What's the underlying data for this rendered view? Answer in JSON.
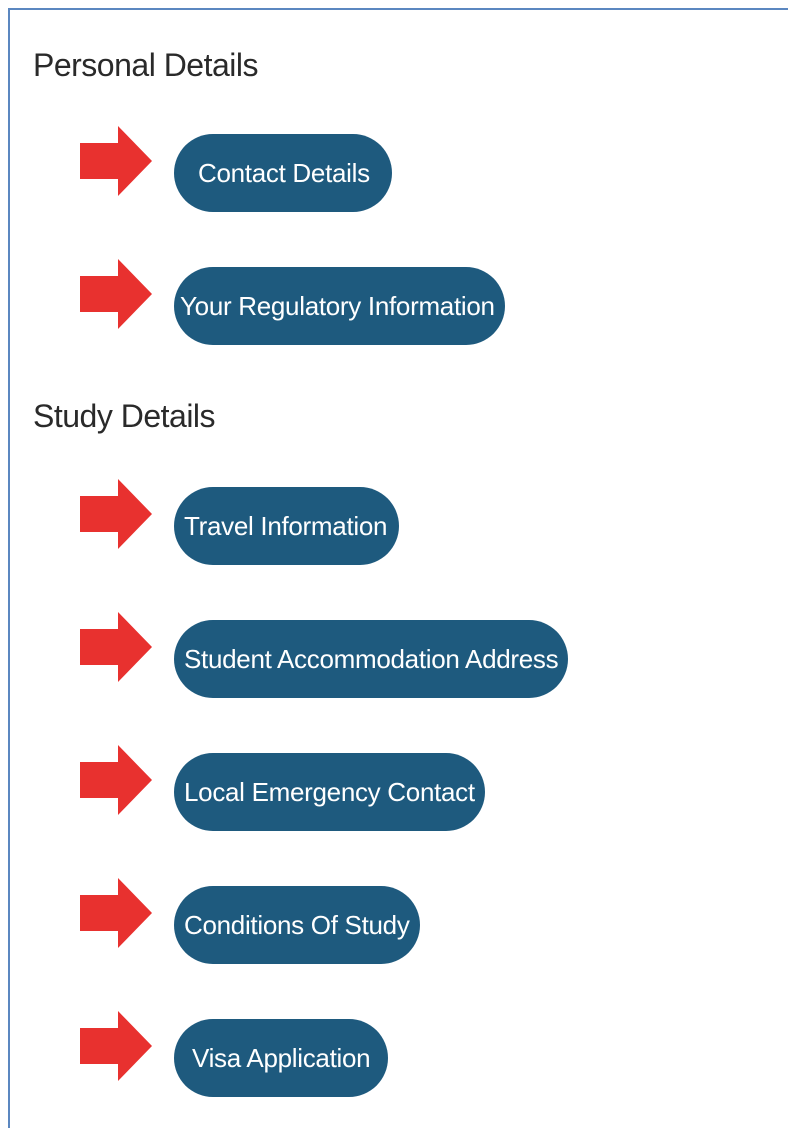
{
  "sections": {
    "personal": {
      "title": "Personal Details",
      "items": [
        "Contact Details",
        "Your Regulatory Information"
      ]
    },
    "study": {
      "title": "Study Details",
      "items": [
        "Travel Information",
        "Student Accommodation Address",
        "Local Emergency Contact",
        "Conditions Of Study",
        "Visa Application"
      ]
    }
  },
  "colors": {
    "button_bg": "#1e5a7e",
    "button_text": "#ffffff",
    "arrow": "#e8312f",
    "panel_border": "#5b87c0",
    "heading_text": "#2a2a2a"
  },
  "icons": {
    "arrow": "arrow-right-icon"
  }
}
